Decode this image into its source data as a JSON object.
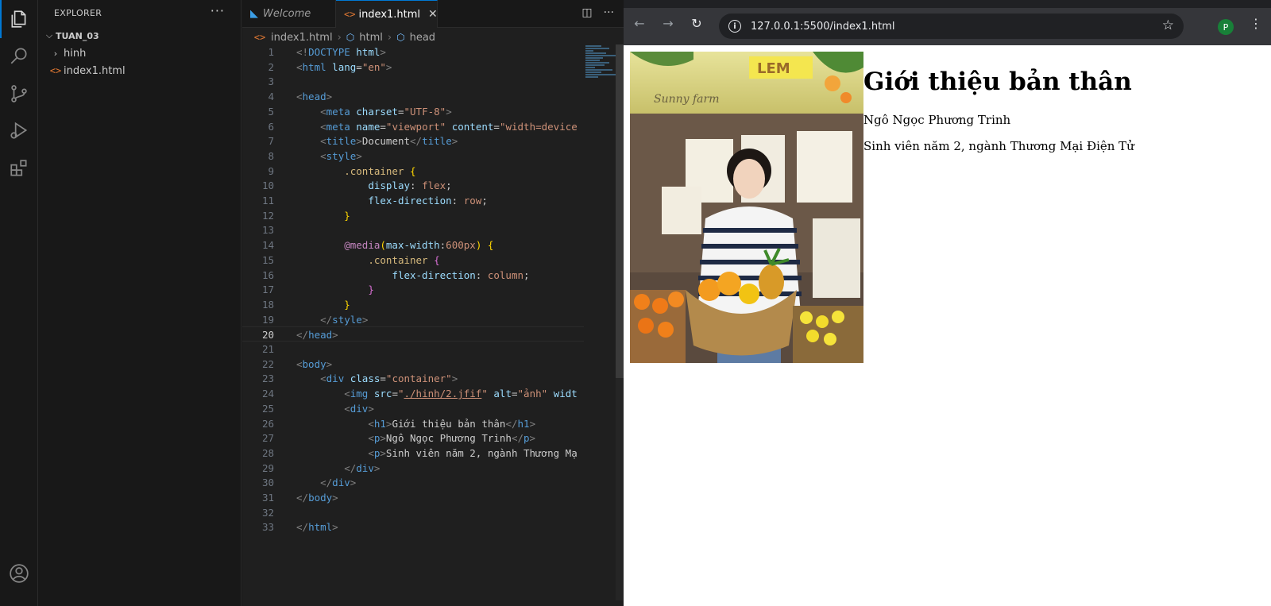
{
  "sidebar": {
    "title": "EXPLORER",
    "more": "···",
    "root_folder": "TUAN_03",
    "items": [
      {
        "label": "hinh",
        "type": "folder"
      },
      {
        "label": "index1.html",
        "type": "file"
      }
    ]
  },
  "editor": {
    "tabs": [
      {
        "label": "Welcome",
        "active": false
      },
      {
        "label": "index1.html",
        "active": true,
        "close": "✕"
      }
    ],
    "breadcrumb": [
      "index1.html",
      "html",
      "head"
    ],
    "current_line": 20,
    "line_numbers": [
      "1",
      "2",
      "3",
      "4",
      "5",
      "6",
      "7",
      "8",
      "9",
      "10",
      "11",
      "12",
      "13",
      "14",
      "15",
      "16",
      "17",
      "18",
      "19",
      "20",
      "21",
      "22",
      "23",
      "24",
      "25",
      "26",
      "27",
      "28",
      "29",
      "30",
      "31",
      "32",
      "33"
    ]
  },
  "browser": {
    "url": "127.0.0.1:5500/index1.html",
    "profile_initial": "P",
    "page": {
      "heading": "Giới thiệu bản thân",
      "name": "Ngô Ngọc Phương Trinh",
      "desc": "Sinh viên năm 2, ngành Thương Mại Điện Tử"
    }
  },
  "photo": {
    "sign_text": "LEM",
    "script_text": "Sunny farm"
  },
  "colors": {
    "accent": "#0078d4",
    "editor_bg": "#1f1f1f",
    "sidebar_bg": "#181818",
    "html_icon": "#e37933"
  }
}
